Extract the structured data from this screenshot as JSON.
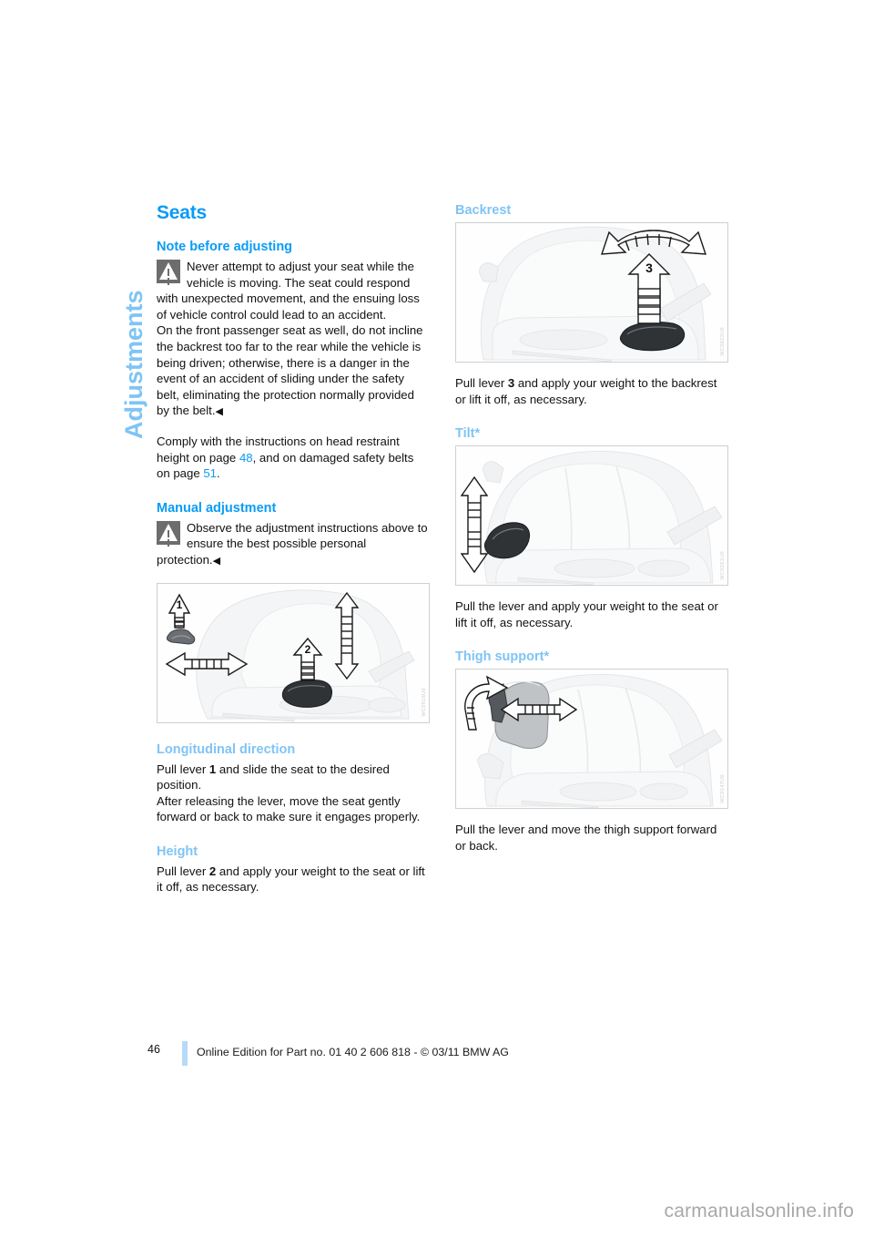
{
  "chapter": {
    "tab_label": "Adjustments"
  },
  "left_column": {
    "title": "Seats",
    "section_note": {
      "heading": "Note before adjusting",
      "warning_icon": "warning-triangle-icon",
      "warning_paragraph": "Never attempt to adjust your seat while the vehicle is moving. The seat could respond with unexpected movement, and the ensuing loss of vehicle control could lead to an accident.",
      "warning_paragraph2": "On the front passenger seat as well, do not incline the backrest too far to the rear while the vehicle is being driven; otherwise, there is a danger in the event of an accident of sliding under the safety belt, eliminating the protection normally provided by the belt.",
      "end_mark": "◀",
      "comply_text_1": "Comply with the instructions on head restraint height on page ",
      "comply_page_1": "48",
      "comply_text_2": ", and on damaged safety belts on page ",
      "comply_page_2": "51",
      "comply_text_3": "."
    },
    "section_manual": {
      "heading": "Manual adjustment",
      "warning_icon": "warning-triangle-icon",
      "warning_paragraph": "Observe the adjustment instructions above to ensure the best possible personal protection.",
      "end_mark": "◀"
    },
    "figure_manual": {
      "name": "seat-manual-adjustment-figure",
      "callout_1": "1",
      "callout_2": "2"
    },
    "section_longitudinal": {
      "heading": "Longitudinal direction",
      "para1_a": "Pull lever ",
      "para1_lever": "1",
      "para1_b": " and slide the seat to the desired position.",
      "para2": "After releasing the lever, move the seat gently forward or back to make sure it engages properly."
    },
    "section_height": {
      "heading": "Height",
      "para_a": "Pull lever ",
      "para_lever": "2",
      "para_b": " and apply your weight to the seat or lift it off, as necessary."
    }
  },
  "right_column": {
    "section_backrest": {
      "heading": "Backrest",
      "figure_name": "seat-backrest-figure",
      "callout_3": "3",
      "para_a": "Pull lever ",
      "para_lever": "3",
      "para_b": " and apply your weight to the backrest or lift it off, as necessary."
    },
    "section_tilt": {
      "heading": "Tilt*",
      "figure_name": "seat-tilt-figure",
      "para": "Pull the lever and apply your weight to the seat or lift it off, as necessary."
    },
    "section_thigh": {
      "heading": "Thigh support*",
      "figure_name": "seat-thigh-support-figure",
      "para": "Pull the lever and move the thigh support forward or back."
    }
  },
  "footer": {
    "page_number": "46",
    "edition_text": "Online Edition for Part no. 01 40 2 606 818 - © 03/11 BMW AG"
  },
  "watermark": {
    "text": "carmanualsonline.info"
  },
  "colors": {
    "heading_primary": "#0a9bf5",
    "heading_secondary": "#7fc4f5",
    "body_text": "#111111",
    "footer_bar": "#b6daf7",
    "watermark": "#a8a8a8"
  }
}
